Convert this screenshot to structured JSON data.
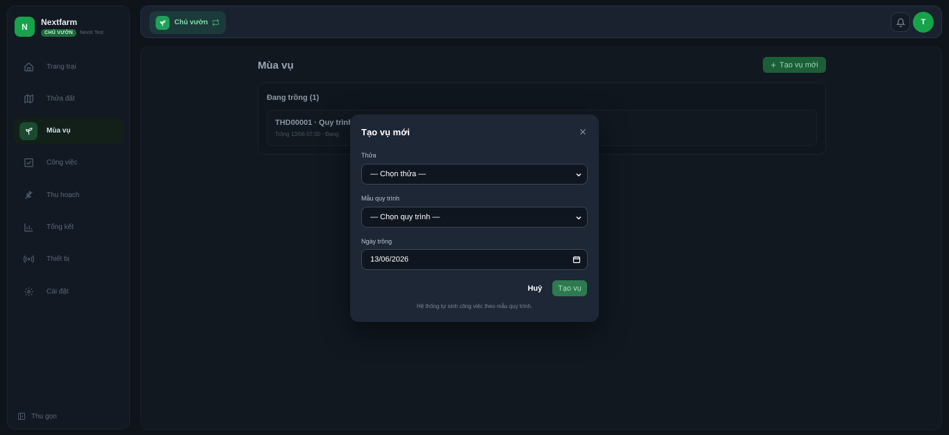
{
  "brand": {
    "initial": "N",
    "name": "Nextfarm",
    "role_badge": "CHỦ VƯỜN",
    "org": "NextX Test"
  },
  "sidebar": {
    "items": [
      {
        "label": "Trang trại",
        "icon": "home-icon"
      },
      {
        "label": "Thửa đất",
        "icon": "map-icon"
      },
      {
        "label": "Mùa vụ",
        "icon": "sprout-icon",
        "active": true
      },
      {
        "label": "Công việc",
        "icon": "check-square-icon"
      },
      {
        "label": "Thu hoạch",
        "icon": "wheat-icon"
      },
      {
        "label": "Tổng kết",
        "icon": "bar-chart-icon"
      },
      {
        "label": "Thiết bị",
        "icon": "radio-icon"
      },
      {
        "label": "Cài đặt",
        "icon": "gear-icon"
      }
    ],
    "collapse_label": "Thu gọn"
  },
  "topbar": {
    "role_label": "Chủ vườn",
    "user_initial": "T"
  },
  "main": {
    "title": "Mùa vụ",
    "create_label": "Tạo vụ mới",
    "section_title": "Đang trồng (1)",
    "card": {
      "name": "THD00001 · Quy trình",
      "meta": "Trồng 13/06 07:00 · Đang"
    }
  },
  "modal": {
    "title": "Tạo vụ mới",
    "plot_label": "Thửa",
    "plot_value": "— Chọn thửa —",
    "template_label": "Mẫu quy trình",
    "template_value": "— Chọn quy trình —",
    "date_label": "Ngày trồng",
    "date_value": "13/06/2026",
    "cancel_label": "Huỷ",
    "submit_label": "Tạo vụ",
    "hint": "Hệ thống tự sinh công việc theo mẫu quy trình."
  },
  "colors": {
    "accent": "#16a34a",
    "background": "#0f141b",
    "modal": "#1e2736"
  }
}
